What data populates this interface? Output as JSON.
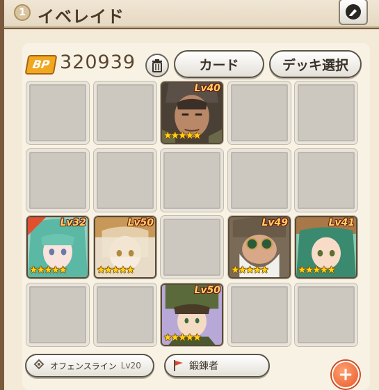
{
  "header": {
    "number": "1",
    "title": "イベレイド",
    "edit_icon": "pencil-icon"
  },
  "toolbar": {
    "bp_badge": "BP",
    "bp_value": "320939",
    "trash_icon": "trash-icon",
    "card_label": "カード",
    "deck_label": "デッキ選択"
  },
  "units": [
    {
      "level": "Lv40",
      "stars": "★★★★★"
    },
    {
      "level": "Lv32",
      "stars": "★★★★★"
    },
    {
      "level": "Lv50",
      "stars": "★★★★★"
    },
    {
      "level": "Lv49",
      "stars": "★★★★★"
    },
    {
      "level": "Lv41",
      "stars": "★★★★★"
    },
    {
      "level": "Lv50",
      "stars": "★★★★★"
    }
  ],
  "footer": {
    "formation_label": "オフェンスライン",
    "formation_level": "Lv20",
    "role_label": "鍛錬者",
    "add_icon": "plus-icon"
  }
}
